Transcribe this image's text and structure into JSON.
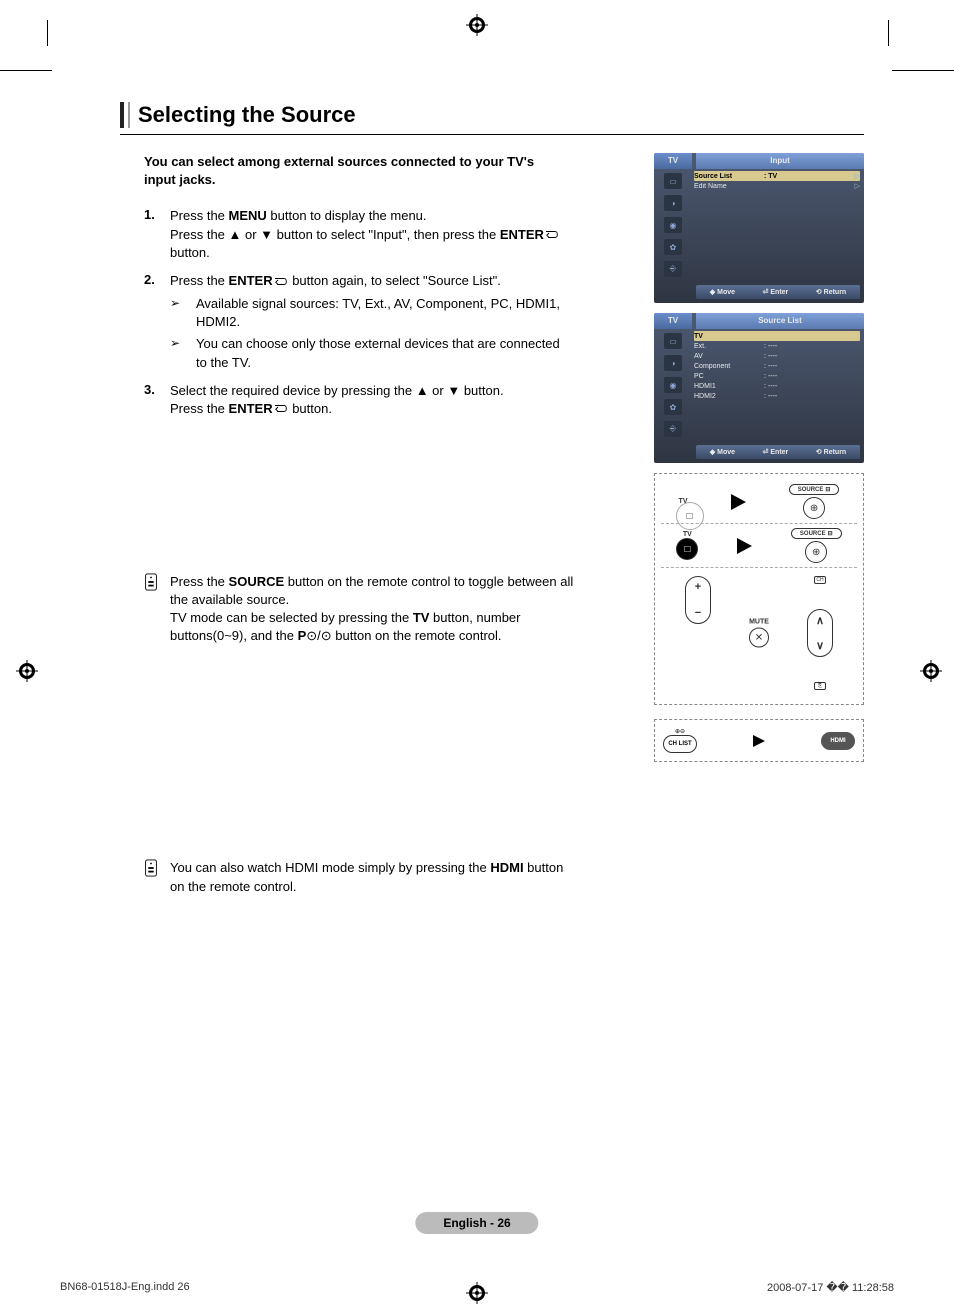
{
  "heading": "Selecting the Source",
  "intro": "You can select among external sources connected to your TV's input jacks.",
  "steps": [
    {
      "num": "1.",
      "parts": [
        "Press the ",
        "MENU",
        " button to display the menu."
      ],
      "cont": [
        "Press the ▲ or ▼ button to select \"Input\", then press the ",
        "ENTER",
        " button."
      ]
    },
    {
      "num": "2.",
      "parts": [
        "Press the ",
        "ENTER",
        " button again, to select \"Source List\"."
      ],
      "subs": [
        "Available signal sources:  TV, Ext., AV, Component, PC, HDMI1, HDMI2.",
        "You can choose only those external devices that are connected to the TV."
      ]
    },
    {
      "num": "3.",
      "parts": [
        "Select the required device by pressing the ▲ or ▼ button."
      ],
      "cont": [
        "Press the ",
        "ENTER",
        " button."
      ]
    }
  ],
  "note1_parts": [
    "Press the ",
    "SOURCE",
    " button on the remote control to toggle between all the available source."
  ],
  "note1_cont": [
    "TV mode can be selected by pressing the ",
    "TV",
    " button, number buttons(0~9), and the ",
    "P",
    " button on the remote control."
  ],
  "note2_parts": [
    "You can also watch HDMI mode simply by pressing the ",
    "HDMI",
    " button on the remote control."
  ],
  "osd1": {
    "tv": "TV",
    "title": "Input",
    "rows": [
      {
        "label": "Source List",
        "val": ":  TV",
        "tri": "▷",
        "sel": true
      },
      {
        "label": "Edit Name",
        "val": "",
        "tri": "▷",
        "sel": false
      }
    ],
    "bar": {
      "move": "Move",
      "enter": "Enter",
      "return": "Return"
    }
  },
  "osd2": {
    "tv": "TV",
    "title": "Source List",
    "rows": [
      {
        "label": "TV",
        "val": "",
        "sel": true
      },
      {
        "label": "Ext.",
        "val": ":  ----"
      },
      {
        "label": "AV",
        "val": ":  ----"
      },
      {
        "label": "Component",
        "val": ":  ----"
      },
      {
        "label": "PC",
        "val": ":  ----"
      },
      {
        "label": "HDMI1",
        "val": ":  ----"
      },
      {
        "label": "HDMI2",
        "val": ":  ----"
      }
    ],
    "bar": {
      "move": "Move",
      "enter": "Enter",
      "return": "Return"
    }
  },
  "remote": {
    "tv": "TV",
    "source": "SOURCE",
    "mute": "MUTE",
    "chlist": "CH LIST",
    "hdmi": "HDMI"
  },
  "page_label": "English - 26",
  "footer_left": "BN68-01518J-Eng.indd   26",
  "footer_right": "2008-07-17   �� 11:28:58"
}
